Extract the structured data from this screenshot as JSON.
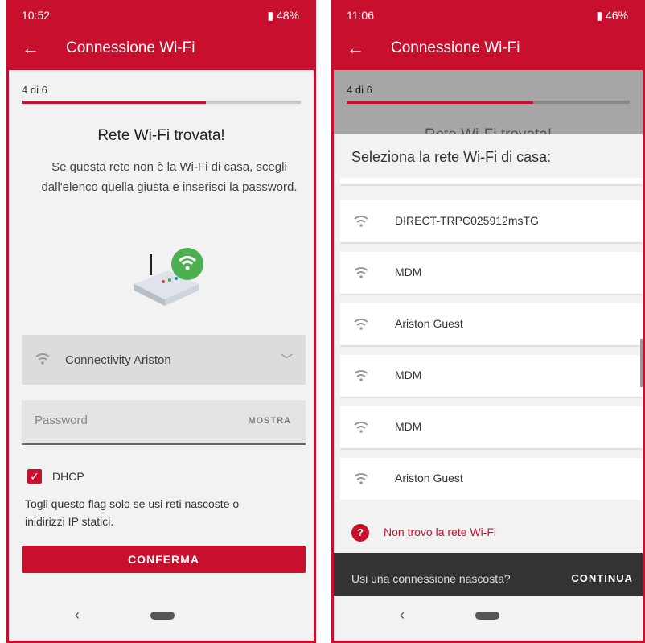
{
  "left_screen": {
    "status": {
      "time": "10:52",
      "battery": "48%"
    },
    "appbar": {
      "back": "←",
      "title": "Connessione Wi-Fi"
    },
    "stepper": {
      "label": "4 di 6",
      "progress": 0.66
    },
    "heading": "Rete Wi-Fi trovata!",
    "description": "Se questa rete non è la Wi-Fi di casa, scegli dall'elenco quella giusta e inserisci la password.",
    "network_select": {
      "value": "Connectivity Ariston"
    },
    "password": {
      "placeholder": "Password",
      "show_label": "MOSTRA"
    },
    "dhcp": {
      "label": "DHCP",
      "checked": true
    },
    "note": "Togli questo flag solo se usi reti nascoste o inidirizzi IP statici.",
    "confirm": "CONFERMA",
    "nav": {
      "back": "‹"
    }
  },
  "right_screen": {
    "status": {
      "time": "11:06",
      "battery": "46%"
    },
    "appbar": {
      "back": "←",
      "title": "Connessione Wi-Fi"
    },
    "stepper": {
      "label": "4 di 6",
      "progress": 0.66
    },
    "heading_peek": "Rete Wi-Fi trovata!",
    "sheet_title": "Seleziona la rete Wi-Fi di casa:",
    "networks": [
      "DIRECT-TRPC025912msTG",
      "MDM",
      "Ariston Guest",
      "MDM",
      "MDM",
      "Ariston Guest"
    ],
    "not_found": "Non trovo la rete Wi-Fi",
    "snackbar": {
      "text": "Usi una connessione nascosta?",
      "action": "CONTINUA"
    },
    "nav": {
      "back": "‹"
    }
  },
  "colors": {
    "brand": "#c8102e",
    "wifi_green": "#4caf50"
  }
}
